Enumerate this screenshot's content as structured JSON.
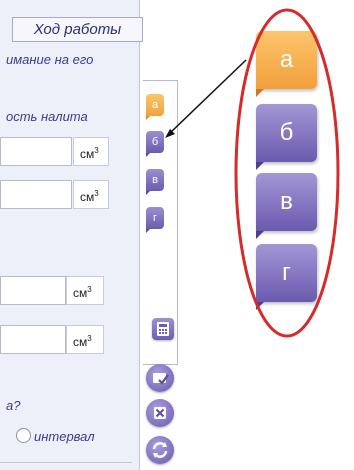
{
  "panel": {
    "title": "Ход работы",
    "line1": "имание на его",
    "line2": "ость налита",
    "question": "а?",
    "radio_label": "интервал"
  },
  "units": {
    "row1": "см",
    "row2": "см",
    "row3": "см",
    "row4": "см",
    "power": "3"
  },
  "small_tabs": [
    "а",
    "б",
    "в",
    "г"
  ],
  "big_tabs": [
    "а",
    "б",
    "в",
    "г"
  ],
  "icons": {
    "calc": "calculator-icon",
    "check": "check-list-icon",
    "reset": "close-icon",
    "refresh": "refresh-icon"
  },
  "colors": {
    "active_tab": "#f5a94a",
    "inactive_tab": "#7c6dbe",
    "highlight": "#d62b2b",
    "text": "#3a3d85"
  }
}
